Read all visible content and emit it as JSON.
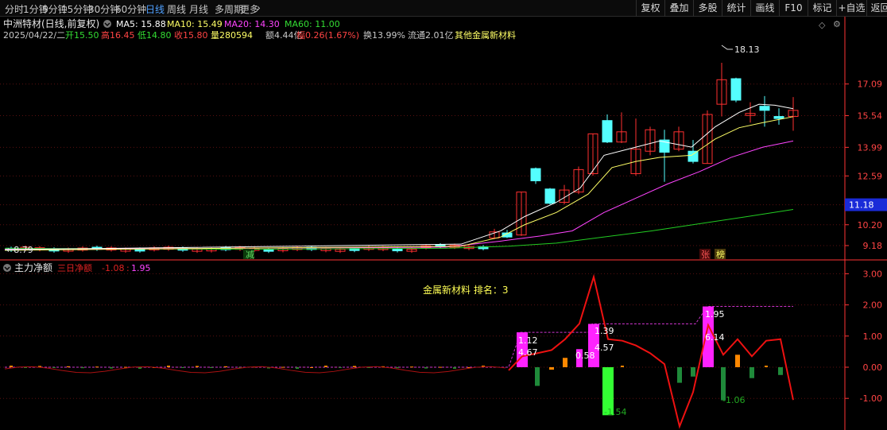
{
  "toolbar": {
    "periods": [
      {
        "label": "分时",
        "active": false
      },
      {
        "label": "1分钟",
        "active": false
      },
      {
        "label": "5分钟",
        "active": false
      },
      {
        "label": "15分钟",
        "active": false
      },
      {
        "label": "30分钟",
        "active": false
      },
      {
        "label": "60分钟",
        "active": false
      },
      {
        "label": "日线",
        "active": true
      },
      {
        "label": "周线",
        "active": false
      },
      {
        "label": "月线",
        "active": false
      },
      {
        "label": "多周期",
        "active": false
      },
      {
        "label": "更多",
        "active": false
      }
    ],
    "tools": [
      "复权",
      "叠加",
      "多股",
      "统计",
      "画线",
      "F10",
      "标记",
      "+自选",
      "返回"
    ]
  },
  "stock": {
    "name_line": "中洲特材(日线,前复权)",
    "ma_items": [
      {
        "label": "MA5: 15.88",
        "color": "#ffffff"
      },
      {
        "label": "MA10: 15.49",
        "color": "#ffff66"
      },
      {
        "label": "MA20: 14.30",
        "color": "#ff44ff"
      },
      {
        "label": "MA60: 11.00",
        "color": "#33dd33"
      }
    ],
    "info_items": [
      {
        "label": "2025/04/22/二",
        "color": "#c8c8c8"
      },
      {
        "label": "开15.50",
        "color": "#33dd33"
      },
      {
        "label": "高16.45",
        "color": "#ff4444"
      },
      {
        "label": "低14.80",
        "color": "#33dd33"
      },
      {
        "label": "收15.80",
        "color": "#ff4444"
      },
      {
        "label": "量280594",
        "color": "#ffff66"
      },
      {
        "label": "额4.44亿",
        "color": "#c8c8c8"
      },
      {
        "label": "幅0.26(1.67%)",
        "color": "#ff4444"
      },
      {
        "label": "换13.99%",
        "color": "#c8c8c8"
      },
      {
        "label": "流通2.01亿",
        "color": "#c8c8c8"
      },
      {
        "label": "其他金属新材料",
        "color": "#ffff66"
      }
    ],
    "price_axis": [
      "17.09",
      "15.54",
      "13.99",
      "12.59",
      "11.18",
      "10.20",
      "9.18"
    ],
    "current_price_tag": "11.18",
    "high_label": "18.13",
    "low_label": "8.79",
    "event_labels": [
      {
        "text": "减",
        "color": "#66dd66"
      },
      {
        "text": "张",
        "color": "#ff5555"
      },
      {
        "text": "榜",
        "color": "#ffff66"
      }
    ]
  },
  "indicator": {
    "title": "主力净额",
    "sub_label": "三日净额",
    "value1": "-1.08",
    "value2": "1.95",
    "rank_label": "金属新材料 排名：3",
    "axis": [
      "3.00",
      "2.00",
      "1.00",
      "0.00",
      "-1.00"
    ],
    "bar_labels": [
      "1.12",
      "4.67",
      "0.58",
      "1.39",
      "4.57",
      "1.95",
      "6.14",
      "-1.54",
      "-1.06"
    ]
  },
  "colors": {
    "up": "#ff3030",
    "down": "#54ffff",
    "ma5": "#ffffff",
    "ma10": "#ffff66",
    "ma20": "#ff44ff",
    "ma60": "#22cc22",
    "axis_red": "#ff3333",
    "net_line": "#ee1111",
    "magenta_bar": "#ff22ff"
  }
}
